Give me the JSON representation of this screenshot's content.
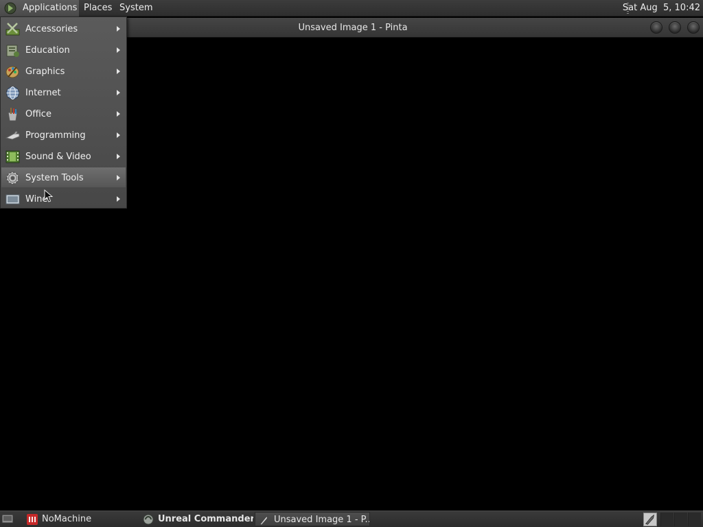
{
  "top_panel": {
    "menus": [
      "Applications",
      "Places",
      "System"
    ],
    "clock": "Sat Aug  5, 10:42"
  },
  "window": {
    "title": "Unsaved Image 1 - Pinta"
  },
  "app_menu": {
    "items": [
      {
        "label": "Accessories",
        "icon": "accessories-icon"
      },
      {
        "label": "Education",
        "icon": "education-icon"
      },
      {
        "label": "Graphics",
        "icon": "graphics-icon"
      },
      {
        "label": "Internet",
        "icon": "internet-icon"
      },
      {
        "label": "Office",
        "icon": "office-icon"
      },
      {
        "label": "Programming",
        "icon": "programming-icon"
      },
      {
        "label": "Sound & Video",
        "icon": "sound-video-icon"
      },
      {
        "label": "System Tools",
        "icon": "system-tools-icon"
      },
      {
        "label": "Wine",
        "icon": "wine-icon"
      }
    ],
    "highlighted": "System Tools"
  },
  "taskbar": {
    "tasks": [
      {
        "label": "NoMachine",
        "icon": "nomachine-icon"
      },
      {
        "label": "Unreal Commander...",
        "icon": "unreal-commander-icon"
      },
      {
        "label": "Unsaved Image 1 - P...",
        "icon": "pinta-icon"
      }
    ]
  }
}
